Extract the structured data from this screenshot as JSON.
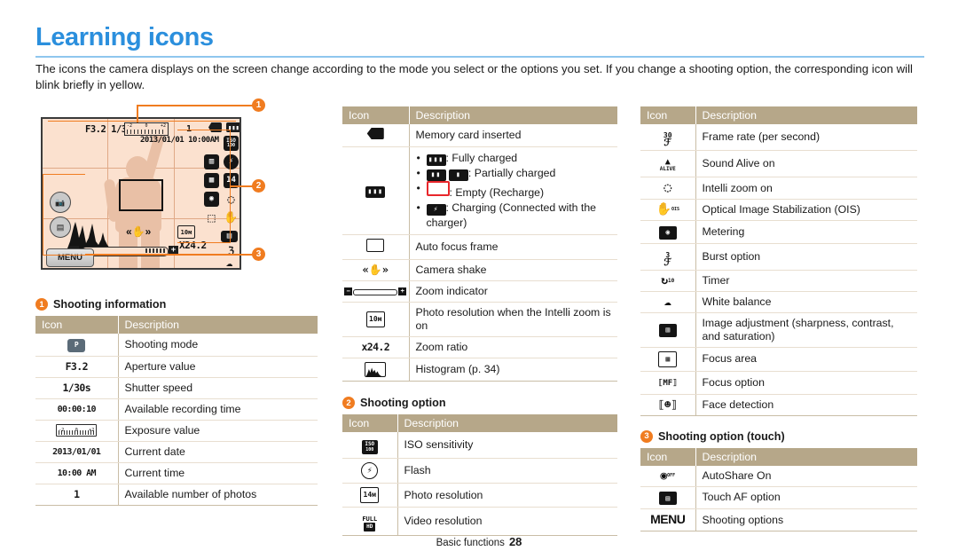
{
  "page": {
    "title": "Learning icons",
    "intro": "The icons the camera displays on the screen change according to the mode you select or the options you set. If you change a shooting option, the corresponding icon will blink briefly in yellow.",
    "footer_label": "Basic functions",
    "footer_page": "28",
    "accent_blue": "#2b8fdd",
    "accent_orange": "#f07c20",
    "table_header_bg": "#b6a789",
    "screen_bg": "#fbe1cf"
  },
  "illustration": {
    "callouts": [
      "1",
      "2",
      "3"
    ],
    "osd": {
      "aperture": "F3.2",
      "shutter": "1/30s",
      "date": "2013/01/01",
      "time": "10:00AM",
      "photos_left": "1",
      "zoom_ratio": "X24.2",
      "resolution": "10м",
      "menu_button": "MENU",
      "ev_left": "-2",
      "ev_center": "0",
      "ev_right": "+2"
    }
  },
  "sections": {
    "shooting_information": {
      "number": "1",
      "title": "Shooting information",
      "headers": [
        "Icon",
        "Description"
      ],
      "rows": [
        {
          "icon": "shooting-mode-icon",
          "icon_text": "",
          "desc": "Shooting mode"
        },
        {
          "icon": "aperture-value-text",
          "icon_text": "F3.2",
          "desc": "Aperture value"
        },
        {
          "icon": "shutter-speed-text",
          "icon_text": "1/30s",
          "desc": "Shutter speed"
        },
        {
          "icon": "recording-time-text",
          "icon_text": "00:00:10",
          "desc": "Available recording time"
        },
        {
          "icon": "exposure-value-icon",
          "icon_text": "",
          "desc": "Exposure value"
        },
        {
          "icon": "current-date-text",
          "icon_text": "2013/01/01",
          "desc": "Current date"
        },
        {
          "icon": "current-time-text",
          "icon_text": "10:00 AM",
          "desc": "Current time"
        },
        {
          "icon": "photo-count-text",
          "icon_text": "1",
          "desc": "Available number of photos"
        }
      ]
    },
    "middle_table": {
      "headers": [
        "Icon",
        "Description"
      ],
      "rows": [
        {
          "icon": "memory-card-icon",
          "desc": "Memory card inserted"
        },
        {
          "icon": "battery-icon",
          "desc_bullets": [
            {
              "glyph": "battery-full-icon",
              "text": ": Fully charged"
            },
            {
              "glyph": "battery-partial-icon",
              "text": ": Partially charged"
            },
            {
              "glyph": "battery-empty-icon",
              "text": ": Empty (Recharge)"
            },
            {
              "glyph": "battery-charging-icon",
              "text": ": Charging (Connected with the charger)"
            }
          ]
        },
        {
          "icon": "auto-focus-frame-icon",
          "desc": "Auto focus frame"
        },
        {
          "icon": "camera-shake-icon",
          "desc": "Camera shake"
        },
        {
          "icon": "zoom-indicator-icon",
          "desc": "Zoom indicator"
        },
        {
          "icon": "photo-resolution-intellizoom-icon",
          "desc": "Photo resolution when the Intelli zoom is on"
        },
        {
          "icon": "zoom-ratio-text",
          "icon_text": "x24.2",
          "desc": "Zoom ratio"
        },
        {
          "icon": "histogram-icon",
          "desc": "Histogram (p. 34)"
        }
      ]
    },
    "shooting_option": {
      "number": "2",
      "title": "Shooting option",
      "headers": [
        "Icon",
        "Description"
      ],
      "rows": [
        {
          "icon": "iso-sensitivity-icon",
          "icon_text": "ISO",
          "desc": "ISO sensitivity"
        },
        {
          "icon": "flash-icon",
          "desc": "Flash"
        },
        {
          "icon": "photo-resolution-icon",
          "icon_text": "14м",
          "desc": "Photo resolution"
        },
        {
          "icon": "video-resolution-icon",
          "icon_text": "FULL HD",
          "desc": "Video resolution"
        }
      ]
    },
    "right_table": {
      "headers": [
        "Icon",
        "Description"
      ],
      "rows": [
        {
          "icon": "frame-rate-icon",
          "icon_text": "30",
          "desc": "Frame rate (per second)"
        },
        {
          "icon": "sound-alive-icon",
          "icon_text": "ALIVE",
          "desc": "Sound Alive on"
        },
        {
          "icon": "intelli-zoom-icon",
          "desc": "Intelli zoom on"
        },
        {
          "icon": "ois-icon",
          "icon_text": "OIS",
          "desc": "Optical Image Stabilization (OIS)"
        },
        {
          "icon": "metering-icon",
          "desc": "Metering"
        },
        {
          "icon": "burst-option-icon",
          "icon_text": "3",
          "desc": "Burst option"
        },
        {
          "icon": "timer-icon",
          "icon_text": "10",
          "desc": "Timer"
        },
        {
          "icon": "white-balance-icon",
          "desc": "White balance"
        },
        {
          "icon": "image-adjustment-icon",
          "desc": "Image adjustment (sharpness, contrast, and saturation)"
        },
        {
          "icon": "focus-area-icon",
          "desc": "Focus area"
        },
        {
          "icon": "focus-option-icon",
          "icon_text": "MF",
          "desc": "Focus option"
        },
        {
          "icon": "face-detection-icon",
          "desc": "Face detection"
        }
      ]
    },
    "shooting_option_touch": {
      "number": "3",
      "title": "Shooting option (touch)",
      "headers": [
        "Icon",
        "Description"
      ],
      "rows": [
        {
          "icon": "autoshare-icon",
          "icon_text": "OFF",
          "desc": "AutoShare On"
        },
        {
          "icon": "touch-af-icon",
          "desc": "Touch AF option"
        },
        {
          "icon": "menu-icon",
          "icon_text": "MENU",
          "desc": "Shooting options"
        }
      ]
    }
  }
}
